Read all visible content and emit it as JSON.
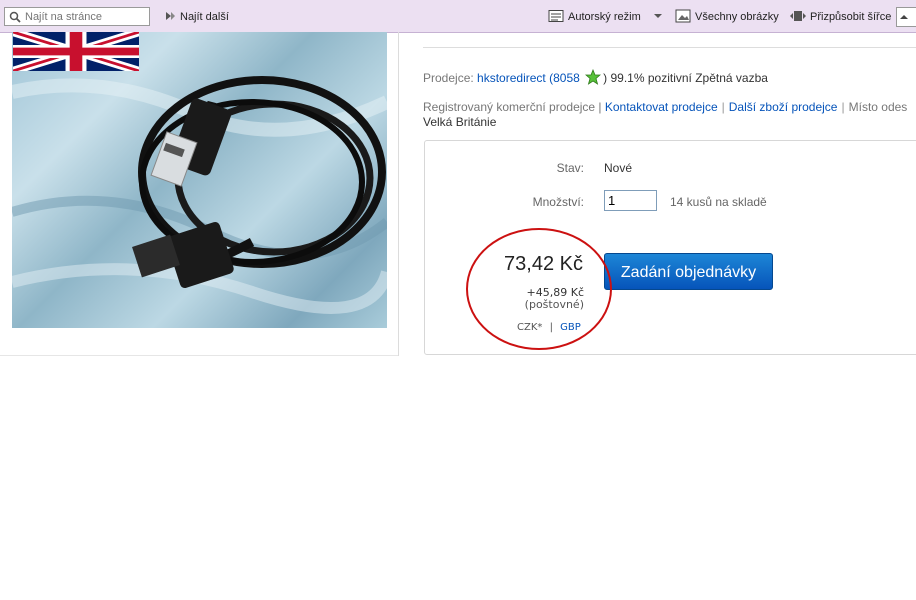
{
  "toolbar": {
    "find_placeholder": "Najít na stránce",
    "find_next": "Najít další",
    "author_mode": "Autorský režim",
    "all_images": "Všechny obrázky",
    "fit_width": "Přizpůsobit šířce"
  },
  "seller": {
    "label": "Prodejce:",
    "name": "hkstoredirect",
    "feedback_open": "(",
    "feedback_count": "8058",
    "feedback_close": ")",
    "positive": "99.1% pozitivní Zpětná vazba"
  },
  "info": {
    "registered": "Registrovaný komerční prodejce |",
    "contact": "Kontaktovat prodejce",
    "more_items": "Další zboží prodejce",
    "location_label": "Místo odes",
    "location_value": "Velká Británie"
  },
  "buybox": {
    "condition_label": "Stav:",
    "condition_value": "Nové",
    "quantity_label": "Množství:",
    "quantity_value": "1",
    "stock": "14 kusů na skladě",
    "price": "73,42 Kč",
    "shipping_price": "+45,89 Kč",
    "shipping_label": "(poštovné)",
    "currency_czk": "CZK*",
    "currency_sep": "|",
    "currency_gbp": "GBP",
    "order_button": "Zadání objednávky"
  },
  "colors": {
    "link": "#0654ba",
    "button": "#0654ba",
    "annotation_circle": "#cc1111",
    "toolbar_bg": "#ece0f2"
  }
}
